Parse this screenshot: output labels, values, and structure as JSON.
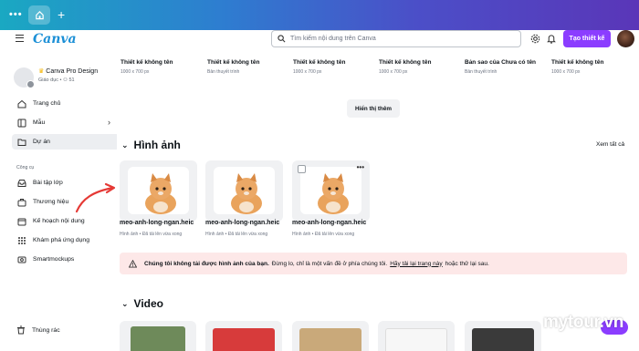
{
  "app": {
    "logo": "Canva"
  },
  "header": {
    "search_placeholder": "Tìm kiếm nội dung trên Canva",
    "create_button": "Tạo thiết kế"
  },
  "sidebar": {
    "team_name": "Canva Pro Design",
    "team_sub": "Giáo dục • ⚇ 51",
    "items": [
      {
        "label": "Trang chủ",
        "icon": "home-icon"
      },
      {
        "label": "Mẫu",
        "icon": "template-icon"
      },
      {
        "label": "Dự án",
        "icon": "folder-icon",
        "active": true
      }
    ],
    "tools_label": "Công cụ",
    "tools": [
      {
        "label": "Bài tập lớp",
        "icon": "inbox-icon"
      },
      {
        "label": "Thương hiệu",
        "icon": "brand-icon"
      },
      {
        "label": "Kế hoạch nội dung",
        "icon": "calendar-icon"
      },
      {
        "label": "Khám phá ứng dụng",
        "icon": "apps-icon"
      },
      {
        "label": "Smartmockups",
        "icon": "mockup-icon"
      }
    ],
    "trash": "Thùng rác"
  },
  "designs": [
    {
      "title": "Thiết kế không tên",
      "sub": "1000 x 700 px"
    },
    {
      "title": "Thiết kế không tên",
      "sub": "Bản thuyết trình"
    },
    {
      "title": "Thiết kế không tên",
      "sub": "1000 x 700 px"
    },
    {
      "title": "Thiết kế không tên",
      "sub": "1000 x 700 px"
    },
    {
      "title": "Bản sao của Chưa có tên",
      "sub": "Bản thuyết trình"
    },
    {
      "title": "Thiết kế không tên",
      "sub": "1000 x 700 px"
    }
  ],
  "show_more": "Hiển thị thêm",
  "images_section": {
    "title": "Hình ảnh",
    "see_all": "Xem tất cả",
    "items": [
      {
        "name": "meo-anh-long-ngan.heic",
        "sub": "Hình ảnh • Đã tải lên vừa xong"
      },
      {
        "name": "meo-anh-long-ngan.heic",
        "sub": "Hình ảnh • Đã tải lên vừa xong"
      },
      {
        "name": "meo-anh-long-ngan.heic",
        "sub": "Hình ảnh • Đã tải lên vừa xong"
      }
    ]
  },
  "alert": {
    "strong": "Chúng tôi không tải được hình ảnh của bạn.",
    "text": "Đừng lo, chỉ là một vấn đề ở phía chúng tôi.",
    "link": "Hãy tải lại trang này",
    "suffix": "hoặc thử lại sau."
  },
  "video_section": {
    "title": "Video"
  },
  "watermark": "mytour.vn",
  "colors": {
    "primary": "#8b3dff",
    "alert_bg": "#fde8e8",
    "logo": "#1b8fd6"
  }
}
